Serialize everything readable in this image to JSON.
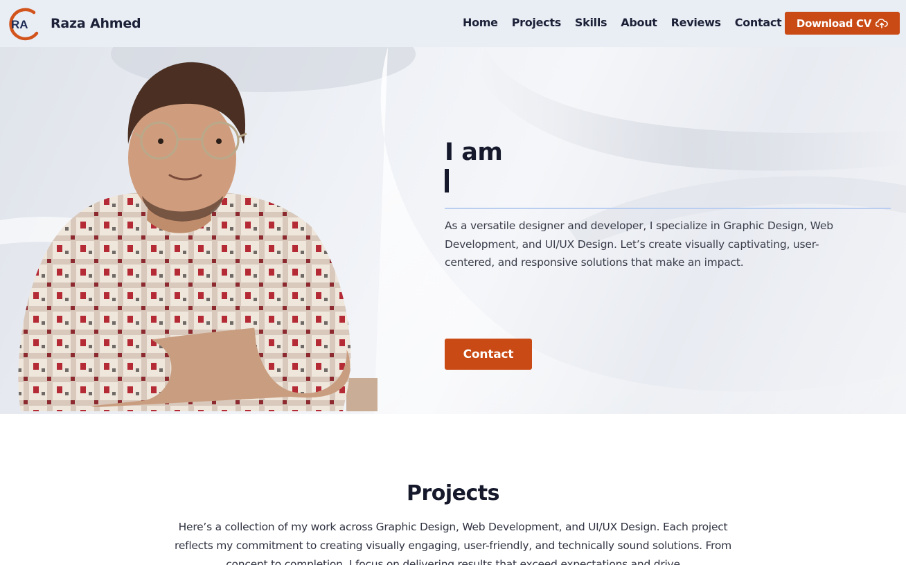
{
  "brand": {
    "logo_text": "RA",
    "name": "Raza Ahmed"
  },
  "nav": {
    "items": [
      {
        "label": "Home"
      },
      {
        "label": "Projects"
      },
      {
        "label": "Skills"
      },
      {
        "label": "About"
      },
      {
        "label": "Reviews"
      },
      {
        "label": "Contact"
      }
    ],
    "cv_button": "Download CV",
    "cv_icon": "cloud-download-icon"
  },
  "hero": {
    "heading": "I am",
    "description": "As a versatile designer and developer, I specialize in Graphic Design, Web Development, and UI/UX Design. Let’s create visually captivating, user-centered, and responsive solutions that make an impact.",
    "contact_button": "Contact"
  },
  "projects": {
    "title": "Projects",
    "description": "Here’s a collection of my work across Graphic Design, Web Development, and UI/UX Design. Each project reflects my commitment to creating visually engaging, user-friendly, and technically sound solutions. From concept to completion, I focus on delivering results that exceed expectations and drive"
  },
  "colors": {
    "accent": "#c94a14",
    "nav_bg": "#e9edf4",
    "heading": "#15192b",
    "rule": "#b9cef0"
  }
}
